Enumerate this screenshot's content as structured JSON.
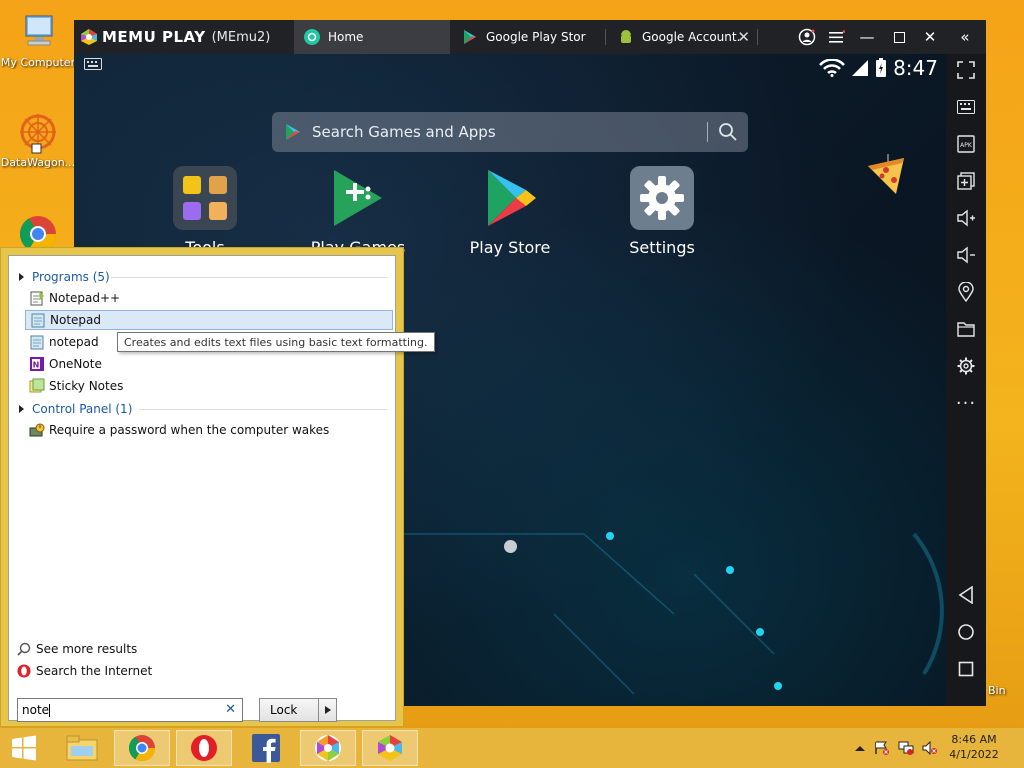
{
  "desktop": {
    "icons": [
      {
        "label": "My Computer"
      },
      {
        "label": "DataWagon..."
      }
    ],
    "recycle_bin_partial": "Bin"
  },
  "memu": {
    "brand": "MEMU PLAY",
    "instance": "(MEmu2)",
    "tabs": [
      {
        "label": "Home"
      },
      {
        "label": "Google Play Stor"
      },
      {
        "label": "Google Account."
      }
    ],
    "status_time": "8:47",
    "search_placeholder": "Search Games and Apps",
    "apps": [
      {
        "label": "Tools"
      },
      {
        "label": "Play Games"
      },
      {
        "label": "Play Store"
      },
      {
        "label": "Settings"
      }
    ],
    "sidebar_icons": [
      "fullscreen-icon",
      "keyboard-icon",
      "apk-icon",
      "multi-window-icon",
      "volume-up-icon",
      "volume-down-icon",
      "location-icon",
      "folder-icon",
      "gear-icon",
      "more-icon",
      "back-icon",
      "home-circle-icon",
      "recents-icon"
    ]
  },
  "start_menu": {
    "programs_header": "Programs (5)",
    "programs": [
      {
        "label": "Notepad++"
      },
      {
        "label": "Notepad"
      },
      {
        "label": "notepad"
      },
      {
        "label": "OneNote"
      },
      {
        "label": "Sticky Notes"
      }
    ],
    "tooltip": "Creates and edits text files using basic text formatting.",
    "control_panel_header": "Control Panel (1)",
    "control_panel": [
      {
        "label": "Require a password when the computer wakes"
      }
    ],
    "see_more": "See more results",
    "search_internet": "Search the Internet",
    "search_value": "note",
    "lock_label": "Lock"
  },
  "taskbar": {
    "time": "8:46 AM",
    "date": "4/1/2022"
  },
  "colors": {
    "desktop": "#f3b41d",
    "taskbar": "#e7b53b",
    "memu_titlebar": "#202226",
    "highlight": "#dbe9f7",
    "link_blue": "#1b5aa6"
  }
}
